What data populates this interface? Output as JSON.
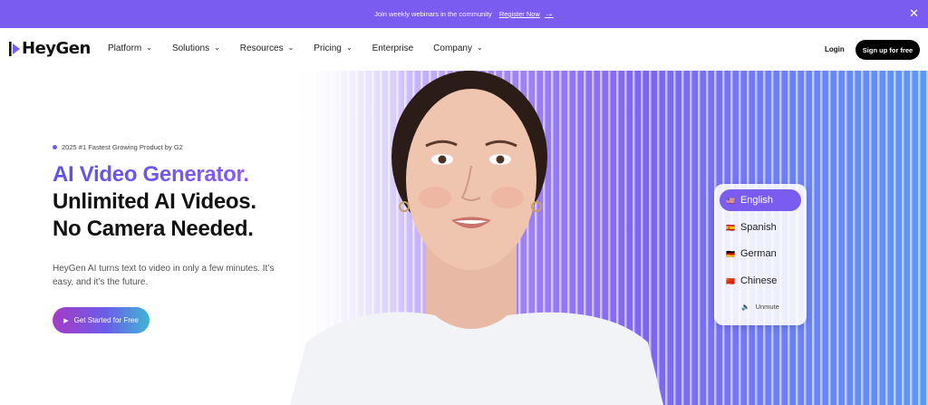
{
  "announcement": {
    "text": "Join weekly webinars in the community",
    "link_label": "Register Now",
    "arrow": "→",
    "close": "✕"
  },
  "brand": {
    "name": "HeyGen",
    "accent": "#7b5cf0"
  },
  "nav": {
    "items": [
      {
        "label": "Platform",
        "chevron": "⌄"
      },
      {
        "label": "Solutions",
        "chevron": "⌄"
      },
      {
        "label": "Resources",
        "chevron": "⌄"
      },
      {
        "label": "Pricing",
        "chevron": "⌄"
      },
      {
        "label": "Enterprise",
        "chevron": ""
      },
      {
        "label": "Company",
        "chevron": "⌄"
      }
    ],
    "login": "Login",
    "signup": "Sign up for free"
  },
  "hero": {
    "badge": "2025 #1 Fastest Growing Product by G2",
    "headline_gradient": "AI Video Generator.",
    "headline_line2": "Unlimited AI Videos.",
    "headline_line3": "No Camera Needed.",
    "subtitle": "HeyGen AI turns text to video in only a few minutes. It’s easy, and it’s the future.",
    "cta": "Get Started for Free",
    "cta_icon": "▶"
  },
  "languages": {
    "items": [
      {
        "flag": "🇺🇸",
        "label": "English",
        "active": true
      },
      {
        "flag": "🇪🇸",
        "label": "Spanish",
        "active": false
      },
      {
        "flag": "🇩🇪",
        "label": "German",
        "active": false
      },
      {
        "flag": "🇨🇳",
        "label": "Chinese",
        "active": false
      }
    ],
    "unmute_icon": "🔈",
    "unmute": "Unmute"
  }
}
